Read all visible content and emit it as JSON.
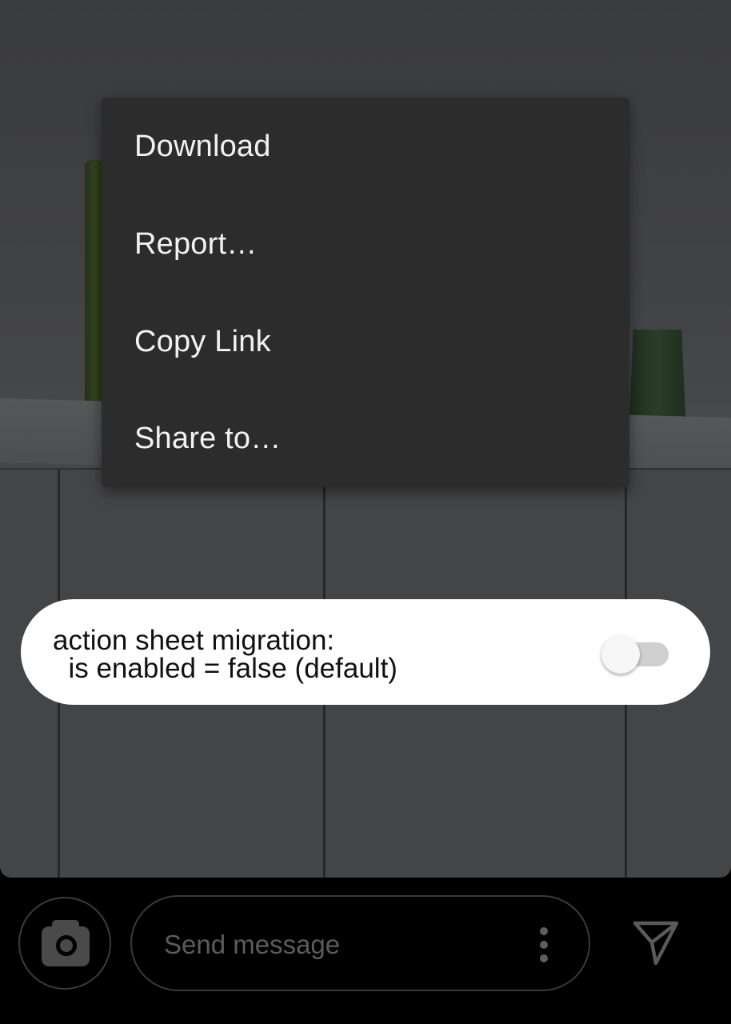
{
  "menu": {
    "items": [
      {
        "label": "Download"
      },
      {
        "label": "Report…"
      },
      {
        "label": "Copy Link"
      },
      {
        "label": "Share to…"
      }
    ]
  },
  "debug_toggle": {
    "text": "action sheet migration:\n  is enabled = false (default)",
    "enabled": false
  },
  "composer": {
    "placeholder": "Send message",
    "camera_icon": "camera-icon",
    "more_icon": "more-vertical-icon",
    "send_icon": "send-icon"
  },
  "colors": {
    "menu_bg": "#2c2c2c",
    "menu_text": "#f2f2f2",
    "pill_bg": "#ffffff",
    "bar_bg": "#000000"
  }
}
